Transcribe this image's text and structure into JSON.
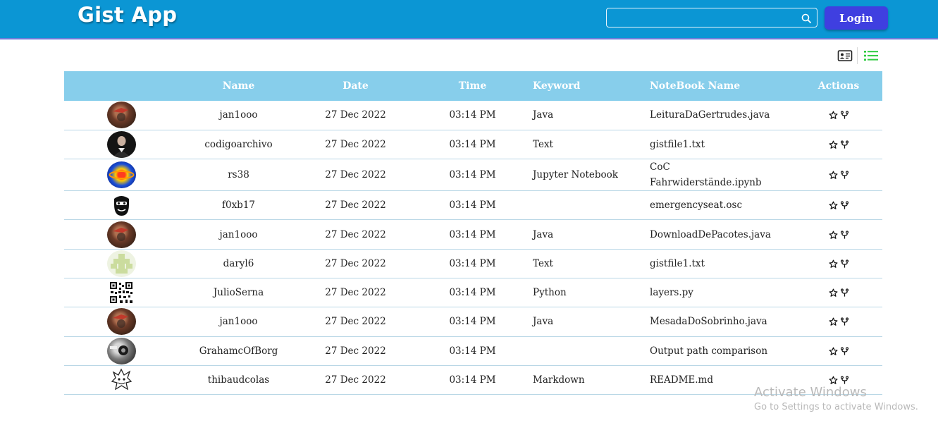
{
  "app": {
    "title": "Gist App"
  },
  "search": {
    "placeholder": "",
    "value": ""
  },
  "login": {
    "label": "Login"
  },
  "view_toggles": {
    "card_icon": "contact-card-icon",
    "list_icon": "list-icon",
    "active": "list"
  },
  "table": {
    "headers": {
      "name": "Name",
      "date": "Date",
      "time": "Time",
      "keyword": "Keyword",
      "notebook": "NoteBook Name",
      "actions": "Actions"
    },
    "rows": [
      {
        "name": "jan1ooo",
        "date": "27 Dec 2022",
        "time": "03:14 PM",
        "keyword": "Java",
        "notebook": "LeituraDaGertrudes.java"
      },
      {
        "name": "codigoarchivo",
        "date": "27 Dec 2022",
        "time": "03:14 PM",
        "keyword": "Text",
        "notebook": "gistfile1.txt"
      },
      {
        "name": "rs38",
        "date": "27 Dec 2022",
        "time": "03:14 PM",
        "keyword": "Jupyter Notebook",
        "notebook_line1": "CoC",
        "notebook_line2": "Fahrwiderstände.ipynb"
      },
      {
        "name": "f0xb17",
        "date": "27 Dec 2022",
        "time": "03:14 PM",
        "keyword": "",
        "notebook": "emergencyseat.osc"
      },
      {
        "name": "jan1ooo",
        "date": "27 Dec 2022",
        "time": "03:14 PM",
        "keyword": "Java",
        "notebook": "DownloadDePacotes.java"
      },
      {
        "name": "daryl6",
        "date": "27 Dec 2022",
        "time": "03:14 PM",
        "keyword": "Text",
        "notebook": "gistfile1.txt"
      },
      {
        "name": "JulioSerna",
        "date": "27 Dec 2022",
        "time": "03:14 PM",
        "keyword": "Python",
        "notebook": "layers.py"
      },
      {
        "name": "jan1ooo",
        "date": "27 Dec 2022",
        "time": "03:14 PM",
        "keyword": "Java",
        "notebook": "MesadaDoSobrinho.java"
      },
      {
        "name": "GrahamcOfBorg",
        "date": "27 Dec 2022",
        "time": "03:14 PM",
        "keyword": "",
        "notebook": "Output path comparison"
      },
      {
        "name": "thibaudcolas",
        "date": "27 Dec 2022",
        "time": "03:14 PM",
        "keyword": "Markdown",
        "notebook": "README.md"
      }
    ]
  },
  "watermark": {
    "line1": "Activate Windows",
    "line2": "Go to Settings to activate Windows."
  },
  "colors": {
    "header_bar": "#0b96d4",
    "table_header": "#87ceeb",
    "login_button": "#3f3fe0",
    "list_icon_active": "#2ecc40"
  }
}
